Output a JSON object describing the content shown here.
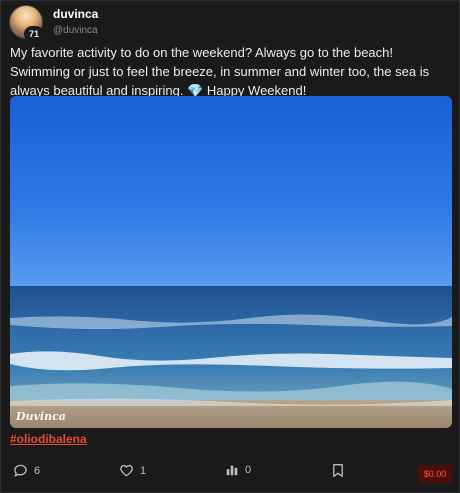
{
  "post": {
    "author": {
      "display_name": "duvinca",
      "handle": "@duvinca",
      "level_badge": "71"
    },
    "text": "My favorite activity to do on the weekend? Always go to the beach! Swimming or just to feel the breeze, in summer and winter too, the sea is always beautiful and inspiring. 💎 Happy Weekend!",
    "image": {
      "description_icon": "beach-photo",
      "watermark": "Duvinca"
    },
    "hashtag": "#oliodibalena",
    "actions": {
      "reply_count": "6",
      "like_count": "1",
      "views_count": "0",
      "tip_amount": "$0.00"
    }
  },
  "colors": {
    "background": "#1a1a1a",
    "hashtag": "#e64a3b",
    "tip_text": "#ff5a45",
    "tip_bg": "#4a0f0b"
  }
}
